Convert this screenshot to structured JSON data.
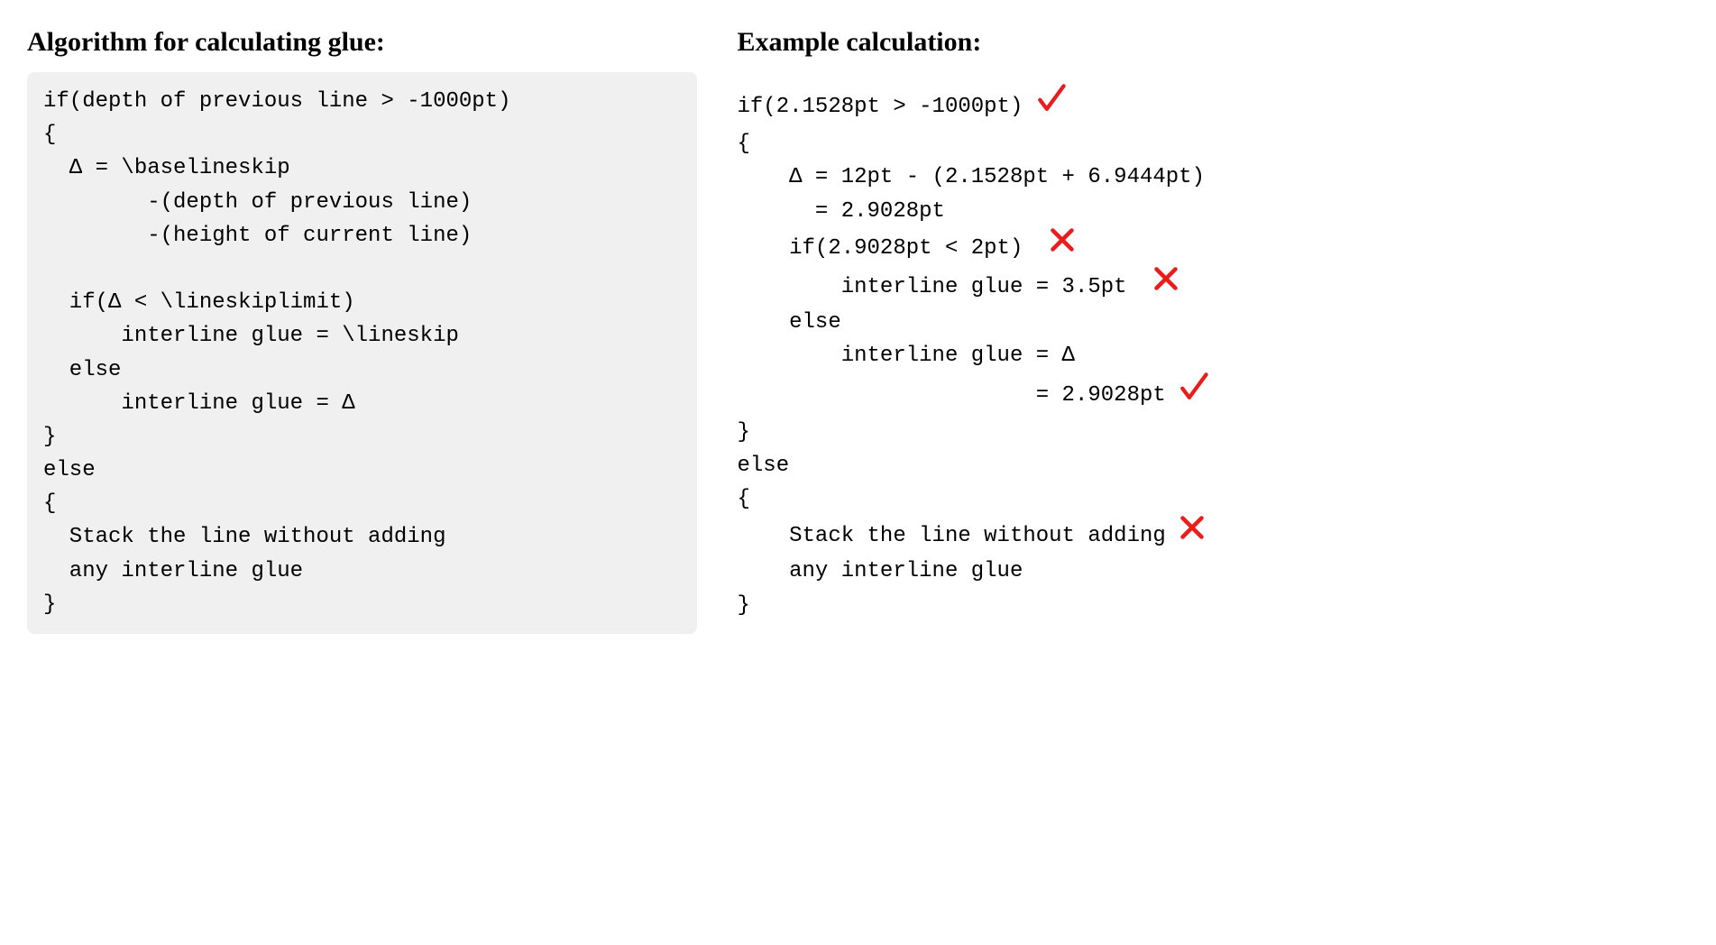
{
  "left": {
    "heading": "Algorithm for calculating glue:",
    "lines": [
      "if(depth of previous line > -1000pt)",
      "{",
      "  Δ = \\baselineskip",
      "        -(depth of previous line)",
      "        -(height of current line)",
      "",
      "  if(Δ < \\lineskiplimit)",
      "      interline glue = \\lineskip",
      "  else",
      "      interline glue = Δ",
      "}",
      "else",
      "{",
      "  Stack the line without adding",
      "  any interline glue",
      "}"
    ]
  },
  "right": {
    "heading": "Example calculation:",
    "lines": [
      {
        "t": "if(2.1528pt > -1000pt) ",
        "mark": "check"
      },
      {
        "t": "{",
        "mark": null
      },
      {
        "t": "    Δ = 12pt - (2.1528pt + 6.9444pt)",
        "mark": null
      },
      {
        "t": "      = 2.9028pt",
        "mark": null
      },
      {
        "t": "    if(2.9028pt < 2pt)  ",
        "mark": "cross"
      },
      {
        "t": "        interline glue = 3.5pt  ",
        "mark": "cross"
      },
      {
        "t": "    else",
        "mark": null
      },
      {
        "t": "        interline glue = Δ",
        "mark": null
      },
      {
        "t": "                       = 2.9028pt ",
        "mark": "check"
      },
      {
        "t": "}",
        "mark": null
      },
      {
        "t": "else",
        "mark": null
      },
      {
        "t": "{",
        "mark": null
      },
      {
        "t": "    Stack the line without adding ",
        "mark": "cross"
      },
      {
        "t": "    any interline glue",
        "mark": null
      },
      {
        "t": "}",
        "mark": null
      }
    ]
  }
}
